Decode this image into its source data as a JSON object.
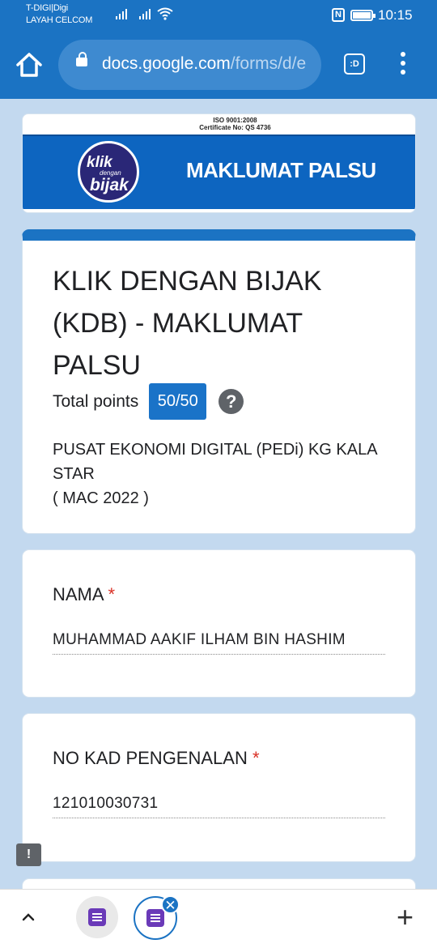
{
  "status_bar": {
    "carrier_line1": "T-DIGI|Digi",
    "carrier_line2": "LAYAH CELCOM",
    "nfc": "N",
    "time": "10:15"
  },
  "browser": {
    "url_host": "docs.google.com",
    "url_path": "/forms/d/e",
    "tabs_label": ":D"
  },
  "banner": {
    "iso_line1": "ISO 9001:2008",
    "iso_line2": "Certificate No: QS 4736",
    "logo_line1": "klik",
    "logo_line2": "dengan",
    "logo_line3": "bijak",
    "title": "MAKLUMAT PALSU"
  },
  "form": {
    "title": "KLIK DENGAN BIJAK (KDB) - MAKLUMAT PALSU",
    "points_label": "Total points",
    "points_value": "50/50",
    "help": "?",
    "desc_line1": "PUSAT EKONOMI DIGITAL (PEDi) KG KALA STAR",
    "desc_line2": "( MAC 2022 )"
  },
  "questions": [
    {
      "label": "NAMA",
      "required": "*",
      "answer": "MUHAMMAD AAKIF ILHAM BIN HASHIM"
    },
    {
      "label": "NO KAD PENGENALAN",
      "required": "*",
      "answer": "121010030731"
    }
  ],
  "feedback": "!",
  "bottom_bar": {
    "close": "✕",
    "new_tab": "+"
  }
}
